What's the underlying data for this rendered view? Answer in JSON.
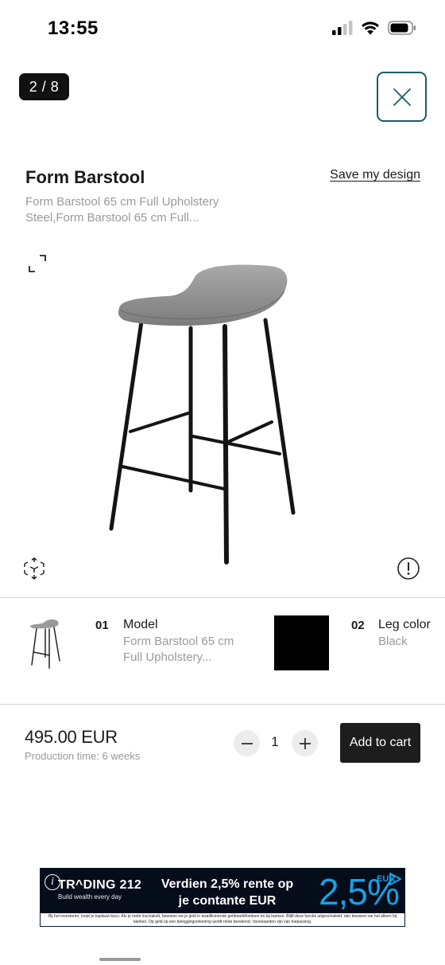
{
  "status_bar": {
    "time": "13:55"
  },
  "gallery": {
    "counter": "2 / 8"
  },
  "product": {
    "title": "Form Barstool",
    "save_label": "Save my design",
    "subtitle": "Form Barstool 65 cm Full Upholstery Steel,Form Barstool 65 cm Full..."
  },
  "config": {
    "items": [
      {
        "num": "01",
        "label": "Model",
        "value": "Form Barstool 65 cm Full Upholstery..."
      },
      {
        "num": "02",
        "label": "Leg color",
        "value": "Black"
      }
    ],
    "swatch_color": "#000000"
  },
  "purchase": {
    "price": "495.00 EUR",
    "production_time": "Production time: 6 weeks",
    "quantity": "1",
    "add_to_cart_label": "Add to cart"
  },
  "ad": {
    "brand": "TR^DING 212",
    "tagline": "Build wealth every day",
    "headline": "Verdien 2,5% rente op je contante EUR",
    "rate": "2,5%",
    "currency": "EUR",
    "disclaimer": "Bij het investeren, loopt je kapitaal risico. Als je rente inschakelt, bewaren we je geld in kwalificerende geldmarktfondsen en bij banken. Blijft deze functie uitgeschakeld, dan bewaren we het alleen bij banken. Op geld op een beleggingsrekening wordt rente berekend. Voorwaarden zijn van toepassing.",
    "colors": {
      "background": "#050c1a",
      "accent": "#17a0e6"
    }
  },
  "icons": {
    "signal": "signal-icon",
    "wifi": "wifi-icon",
    "battery": "battery-icon",
    "close": "close-icon",
    "expand": "expand-icon",
    "ar": "ar-view-icon",
    "info": "info-icon",
    "minus": "minus-icon",
    "plus": "plus-icon"
  }
}
